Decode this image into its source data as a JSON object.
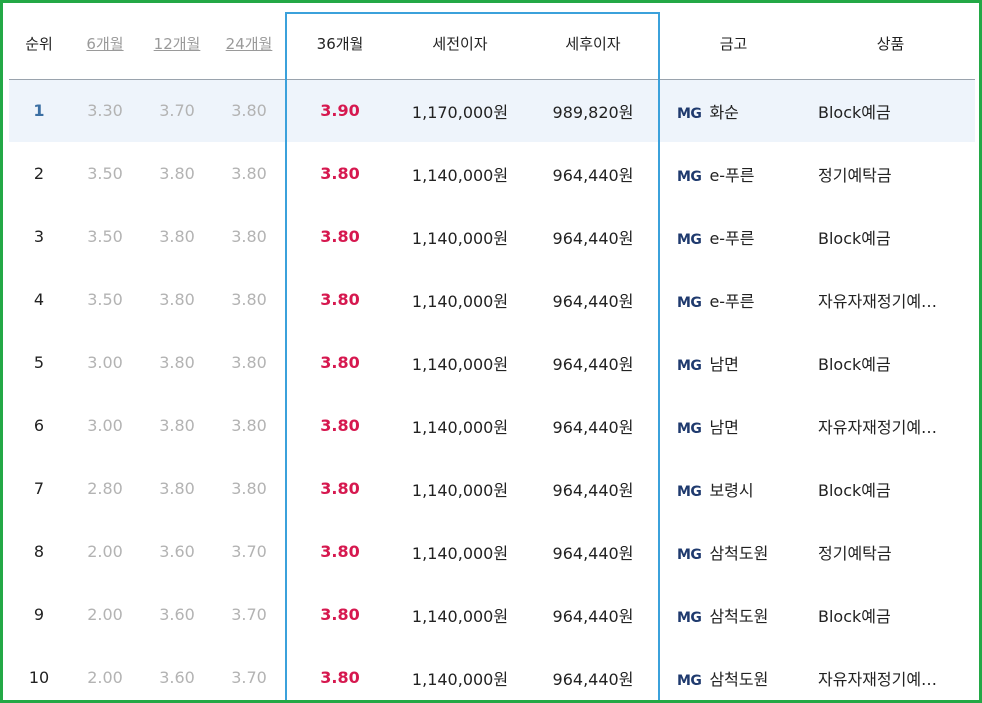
{
  "header": {
    "rank": "순위",
    "m6": "6개월",
    "m12": "12개월",
    "m24": "24개월",
    "m36": "36개월",
    "pretax": "세전이자",
    "aftertax": "세후이자",
    "bank": "금고",
    "product": "상품"
  },
  "rows": [
    {
      "rank": "1",
      "m6": "3.30",
      "m12": "3.70",
      "m24": "3.80",
      "m36": "3.90",
      "pretax": "1,170,000원",
      "aftertax": "989,820원",
      "mg": "MG",
      "bank": "화순",
      "product": "Block예금"
    },
    {
      "rank": "2",
      "m6": "3.50",
      "m12": "3.80",
      "m24": "3.80",
      "m36": "3.80",
      "pretax": "1,140,000원",
      "aftertax": "964,440원",
      "mg": "MG",
      "bank": "e-푸른",
      "product": "정기예탁금"
    },
    {
      "rank": "3",
      "m6": "3.50",
      "m12": "3.80",
      "m24": "3.80",
      "m36": "3.80",
      "pretax": "1,140,000원",
      "aftertax": "964,440원",
      "mg": "MG",
      "bank": "e-푸른",
      "product": "Block예금"
    },
    {
      "rank": "4",
      "m6": "3.50",
      "m12": "3.80",
      "m24": "3.80",
      "m36": "3.80",
      "pretax": "1,140,000원",
      "aftertax": "964,440원",
      "mg": "MG",
      "bank": "e-푸른",
      "product": "자유자재정기예…"
    },
    {
      "rank": "5",
      "m6": "3.00",
      "m12": "3.80",
      "m24": "3.80",
      "m36": "3.80",
      "pretax": "1,140,000원",
      "aftertax": "964,440원",
      "mg": "MG",
      "bank": "남면",
      "product": "Block예금"
    },
    {
      "rank": "6",
      "m6": "3.00",
      "m12": "3.80",
      "m24": "3.80",
      "m36": "3.80",
      "pretax": "1,140,000원",
      "aftertax": "964,440원",
      "mg": "MG",
      "bank": "남면",
      "product": "자유자재정기예…"
    },
    {
      "rank": "7",
      "m6": "2.80",
      "m12": "3.80",
      "m24": "3.80",
      "m36": "3.80",
      "pretax": "1,140,000원",
      "aftertax": "964,440원",
      "mg": "MG",
      "bank": "보령시",
      "product": "Block예금"
    },
    {
      "rank": "8",
      "m6": "2.00",
      "m12": "3.60",
      "m24": "3.70",
      "m36": "3.80",
      "pretax": "1,140,000원",
      "aftertax": "964,440원",
      "mg": "MG",
      "bank": "삼척도원",
      "product": "정기예탁금"
    },
    {
      "rank": "9",
      "m6": "2.00",
      "m12": "3.60",
      "m24": "3.70",
      "m36": "3.80",
      "pretax": "1,140,000원",
      "aftertax": "964,440원",
      "mg": "MG",
      "bank": "삼척도원",
      "product": "Block예금"
    },
    {
      "rank": "10",
      "m6": "2.00",
      "m12": "3.60",
      "m24": "3.70",
      "m36": "3.80",
      "pretax": "1,140,000원",
      "aftertax": "964,440원",
      "mg": "MG",
      "bank": "삼척도원",
      "product": "자유자재정기예…"
    }
  ],
  "colors": {
    "frame": "#23a846",
    "highlight_border": "#3ba1db",
    "rate_emphasis": "#d6184f",
    "top_row_bg": "#eef4fb",
    "mg_logo": "#1f3a6e"
  }
}
